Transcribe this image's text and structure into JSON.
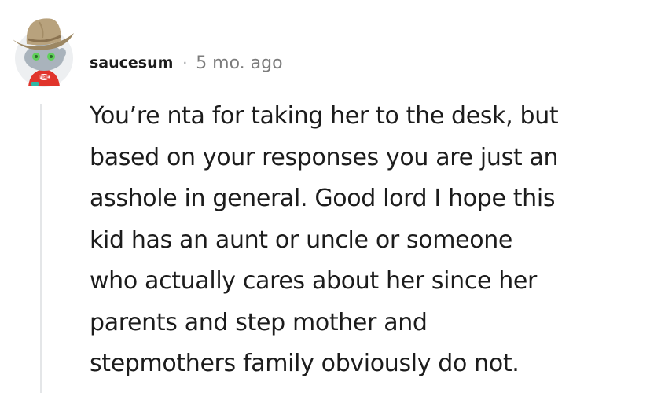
{
  "comment": {
    "author": "saucesum",
    "separator": "·",
    "timestamp": "5 mo. ago",
    "body_lines": [
      "You’re nta for taking her to the desk, but",
      "based on your responses you are just an",
      "asshole in general. Good lord I hope this",
      "kid has an aunt or uncle or someone",
      "who actually cares about her since her",
      "parents and step mother and",
      "stepmothers family obviously do not."
    ]
  },
  "avatar": {
    "icon": "snoo-cowboy-avatar-icon",
    "shirt_badge": "FIRE"
  },
  "colors": {
    "text": "#1c1c1c",
    "meta_gray": "#7c7c7c",
    "thread_line": "#e4e6e8",
    "avatar_bg": "#edeff1",
    "hat": "#b8a27d",
    "shirt": "#e0342b"
  }
}
